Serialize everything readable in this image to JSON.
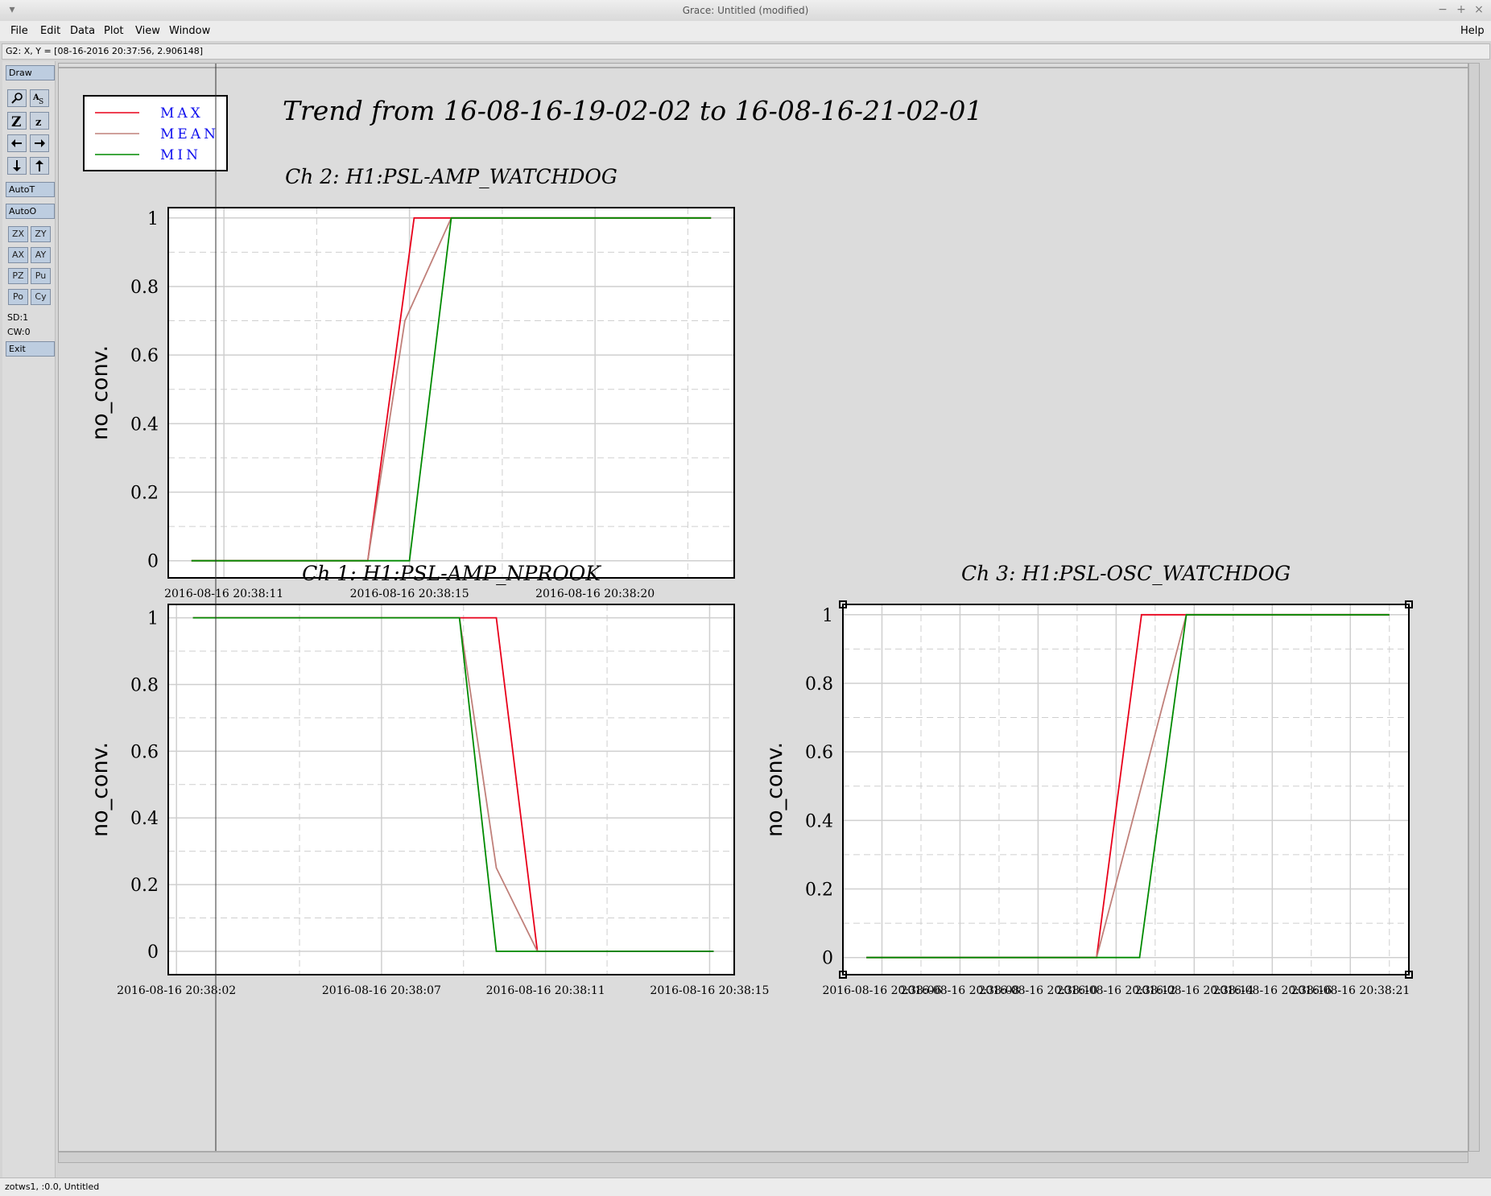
{
  "window": {
    "title": "Grace: Untitled (modified)"
  },
  "menubar": {
    "file": "File",
    "edit": "Edit",
    "data": "Data",
    "plot": "Plot",
    "view": "View",
    "window": "Window",
    "help": "Help"
  },
  "coord_readout": "G2: X, Y = [08-16-2016 20:37:56, 2.906148]",
  "toolbar": {
    "draw": "Draw",
    "autot": "AutoT",
    "autoo": "AutoO",
    "zx": "ZX",
    "zy": "ZY",
    "ax": "AX",
    "ay": "AY",
    "pz": "PZ",
    "pu": "Pu",
    "po": "Po",
    "cy": "Cy",
    "sd": "SD:1",
    "cw": "CW:0",
    "exit": "Exit"
  },
  "legend": [
    {
      "label": "MAX",
      "color": "#e8001a"
    },
    {
      "label": "MEAN",
      "color": "#c0807a"
    },
    {
      "label": "MIN",
      "color": "#008a00"
    }
  ],
  "main_title": "Trend from 16-08-16-19-02-02 to 16-08-16-21-02-01",
  "status": "zotws1, :0.0, Untitled",
  "chart_data": [
    {
      "type": "line",
      "title": "Ch 2: H1:PSL-AMP_WATCHDOG",
      "ylabel": "no_conv.",
      "xlabel": "",
      "ylim": [
        -0.05,
        1.03
      ],
      "xlim": [
        9.8,
        22.0
      ],
      "y_ticks": [
        "0",
        "0.2",
        "0.4",
        "0.6",
        "0.8",
        "1"
      ],
      "x_ticks": [
        {
          "x": 11,
          "label": "2016-08-16 20:38:11"
        },
        {
          "x": 15,
          "label": "2016-08-16 20:38:15"
        },
        {
          "x": 19,
          "label": "2016-08-16 20:38:20"
        }
      ],
      "grid": true,
      "series": [
        {
          "name": "MAX",
          "x": [
            10.3,
            14.1,
            15.1,
            21.5
          ],
          "y": [
            0,
            0,
            1,
            1
          ]
        },
        {
          "name": "MEAN",
          "x": [
            10.3,
            14.1,
            14.9,
            15.9,
            21.5
          ],
          "y": [
            0,
            0,
            0.7,
            1,
            1
          ]
        },
        {
          "name": "MIN",
          "x": [
            10.3,
            15.0,
            15.9,
            21.5
          ],
          "y": [
            0,
            0,
            1,
            1
          ]
        }
      ]
    },
    {
      "type": "line",
      "title": "Ch 1: H1:PSL-AMP_NPROOK",
      "ylabel": "no_conv.",
      "xlabel": "",
      "ylim": [
        -0.07,
        1.04
      ],
      "xlim": [
        2.0,
        15.8
      ],
      "y_ticks": [
        "0",
        "0.2",
        "0.4",
        "0.6",
        "0.8",
        "1"
      ],
      "x_ticks": [
        {
          "x": 2.2,
          "label": "2016-08-16 20:38:02"
        },
        {
          "x": 7.2,
          "label": "2016-08-16 20:38:07"
        },
        {
          "x": 11.2,
          "label": "2016-08-16 20:38:11"
        },
        {
          "x": 15.2,
          "label": "2016-08-16 20:38:15"
        }
      ],
      "grid": true,
      "series": [
        {
          "name": "MAX",
          "x": [
            2.6,
            9.1,
            10.0,
            11.0,
            15.3
          ],
          "y": [
            1,
            1,
            1,
            0,
            0
          ]
        },
        {
          "name": "MEAN",
          "x": [
            2.6,
            9.1,
            10.0,
            11.0,
            15.3
          ],
          "y": [
            1,
            1,
            0.25,
            0,
            0
          ]
        },
        {
          "name": "MIN",
          "x": [
            2.6,
            9.1,
            10.0,
            15.3
          ],
          "y": [
            1,
            1,
            0,
            0
          ]
        }
      ]
    },
    {
      "type": "line",
      "title": "Ch 3: H1:PSL-OSC_WATCHDOG",
      "ylabel": "no_conv.",
      "xlabel": "",
      "ylim": [
        -0.05,
        1.03
      ],
      "xlim": [
        0,
        29
      ],
      "y_ticks": [
        "0",
        "0.2",
        "0.4",
        "0.6",
        "0.8",
        "1"
      ],
      "x_ticks": [
        {
          "x": 2,
          "label": "2016-08-16 20:38:06"
        },
        {
          "x": 6,
          "label": "2016-08-16 20:38:08"
        },
        {
          "x": 10,
          "label": "2016-08-16 20:38:10"
        },
        {
          "x": 14,
          "label": "2016-08-16 20:38:12"
        },
        {
          "x": 18,
          "label": "2016-08-16 20:38:14"
        },
        {
          "x": 22,
          "label": "2016-08-16 20:38:16"
        },
        {
          "x": 26,
          "label": "2016-08-16 20:38:21"
        }
      ],
      "grid": true,
      "series": [
        {
          "name": "MAX",
          "x": [
            1.2,
            13.0,
            15.3,
            18.0,
            28.0
          ],
          "y": [
            0,
            0,
            1,
            1,
            1
          ]
        },
        {
          "name": "MEAN",
          "x": [
            1.2,
            13.0,
            17.6,
            28.0
          ],
          "y": [
            0,
            0,
            1,
            1
          ]
        },
        {
          "name": "MIN",
          "x": [
            1.2,
            15.2,
            17.6,
            28.0
          ],
          "y": [
            0,
            0,
            1,
            1
          ]
        }
      ]
    }
  ]
}
